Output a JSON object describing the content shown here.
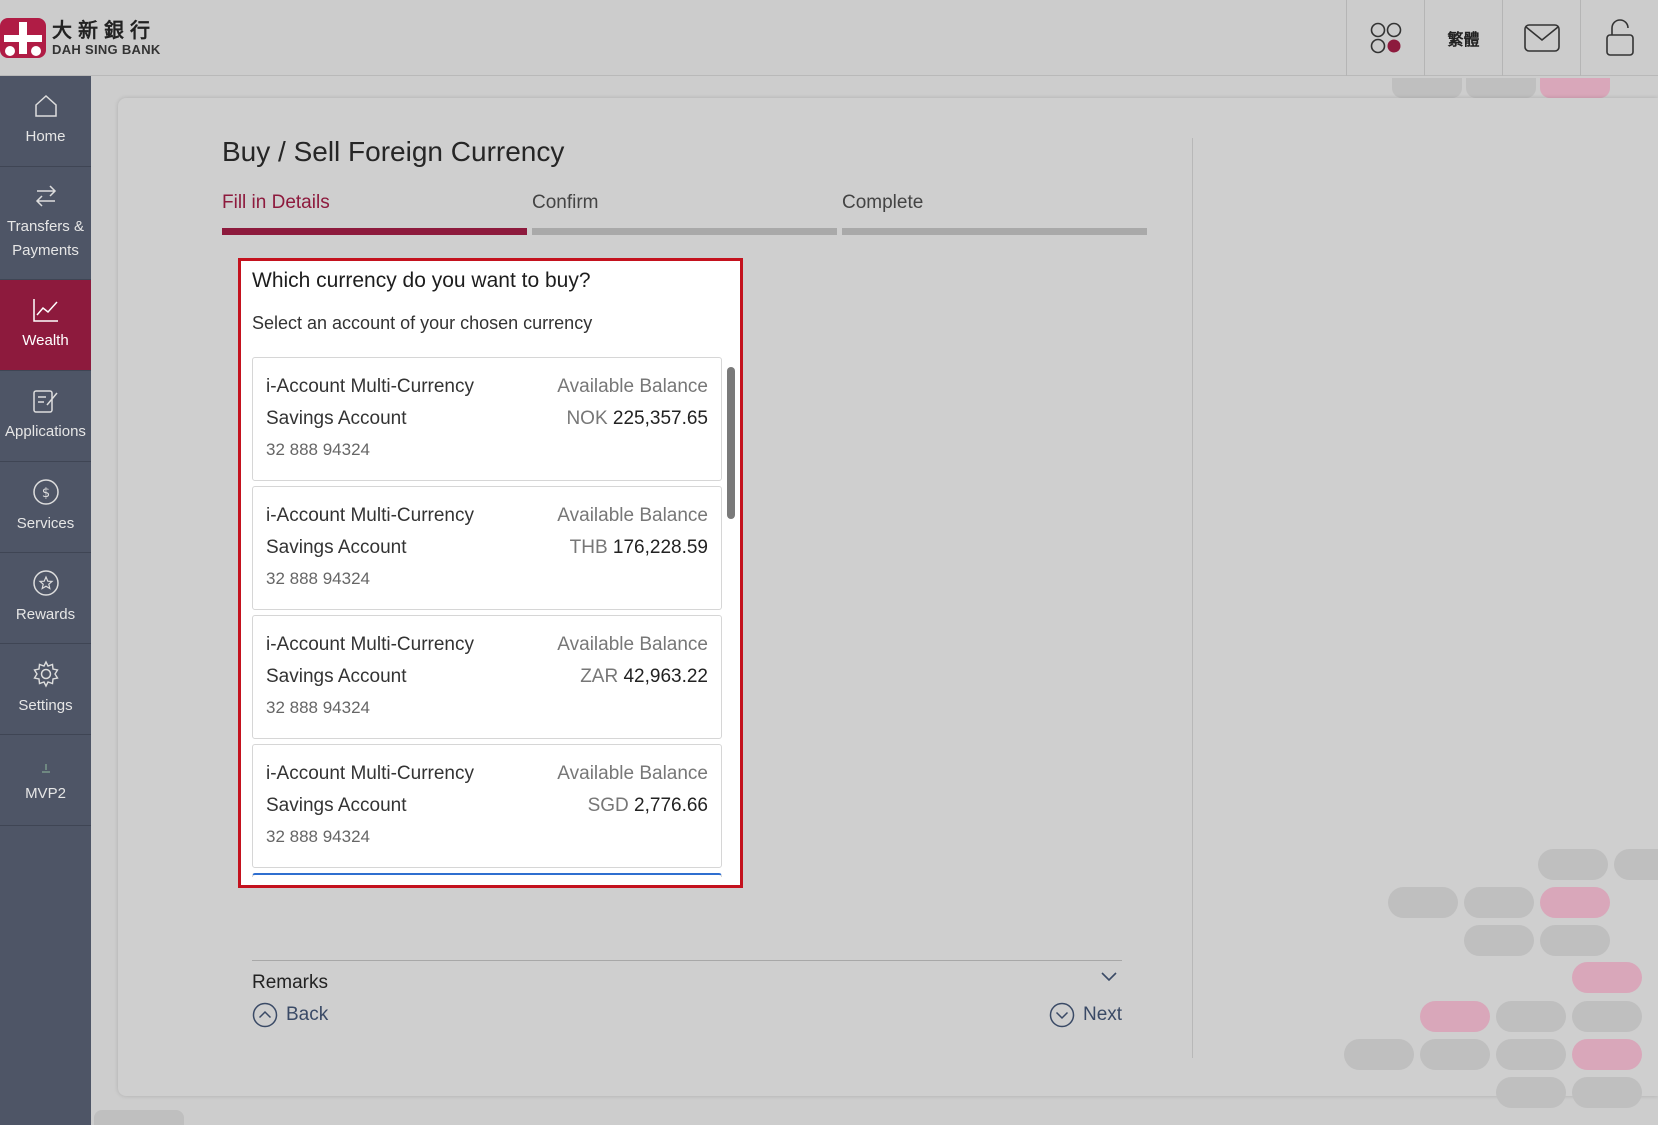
{
  "brand": {
    "name_cn": "大新銀行",
    "name_en": "DAH SING BANK",
    "color": "#8d1a3d"
  },
  "header": {
    "language_label": "繁體"
  },
  "sidebar": {
    "items": [
      {
        "label": "Home",
        "icon": "home-icon"
      },
      {
        "label": "Transfers & Payments",
        "icon": "transfer-icon"
      },
      {
        "label": "Wealth",
        "icon": "chart-icon",
        "active": true
      },
      {
        "label": "Applications",
        "icon": "edit-icon"
      },
      {
        "label": "Services",
        "icon": "dollar-icon"
      },
      {
        "label": "Rewards",
        "icon": "star-icon"
      },
      {
        "label": "Settings",
        "icon": "gear-icon"
      },
      {
        "label": "MVP2",
        "icon": "upload-icon"
      }
    ]
  },
  "page": {
    "title": "Buy / Sell Foreign Currency",
    "steps": [
      {
        "label": "Fill in Details",
        "active": true
      },
      {
        "label": "Confirm",
        "active": false
      },
      {
        "label": "Complete",
        "active": false
      }
    ],
    "question": "Which currency do you want to buy?",
    "instruction": "Select an account of your chosen currency",
    "accounts": [
      {
        "name_line1": "i-Account Multi-Currency",
        "name_line2": "Savings Account",
        "number": "32 888 94324",
        "balance_label": "Available Balance",
        "currency": "NOK",
        "amount": "225,357.65"
      },
      {
        "name_line1": "i-Account Multi-Currency",
        "name_line2": "Savings Account",
        "number": "32 888 94324",
        "balance_label": "Available Balance",
        "currency": "THB",
        "amount": "176,228.59"
      },
      {
        "name_line1": "i-Account Multi-Currency",
        "name_line2": "Savings Account",
        "number": "32 888 94324",
        "balance_label": "Available Balance",
        "currency": "ZAR",
        "amount": "42,963.22"
      },
      {
        "name_line1": "i-Account Multi-Currency",
        "name_line2": "Savings Account",
        "number": "32 888 94324",
        "balance_label": "Available Balance",
        "currency": "SGD",
        "amount": "2,776.66"
      }
    ],
    "remarks_label": "Remarks",
    "back_label": "Back",
    "next_label": "Next"
  }
}
